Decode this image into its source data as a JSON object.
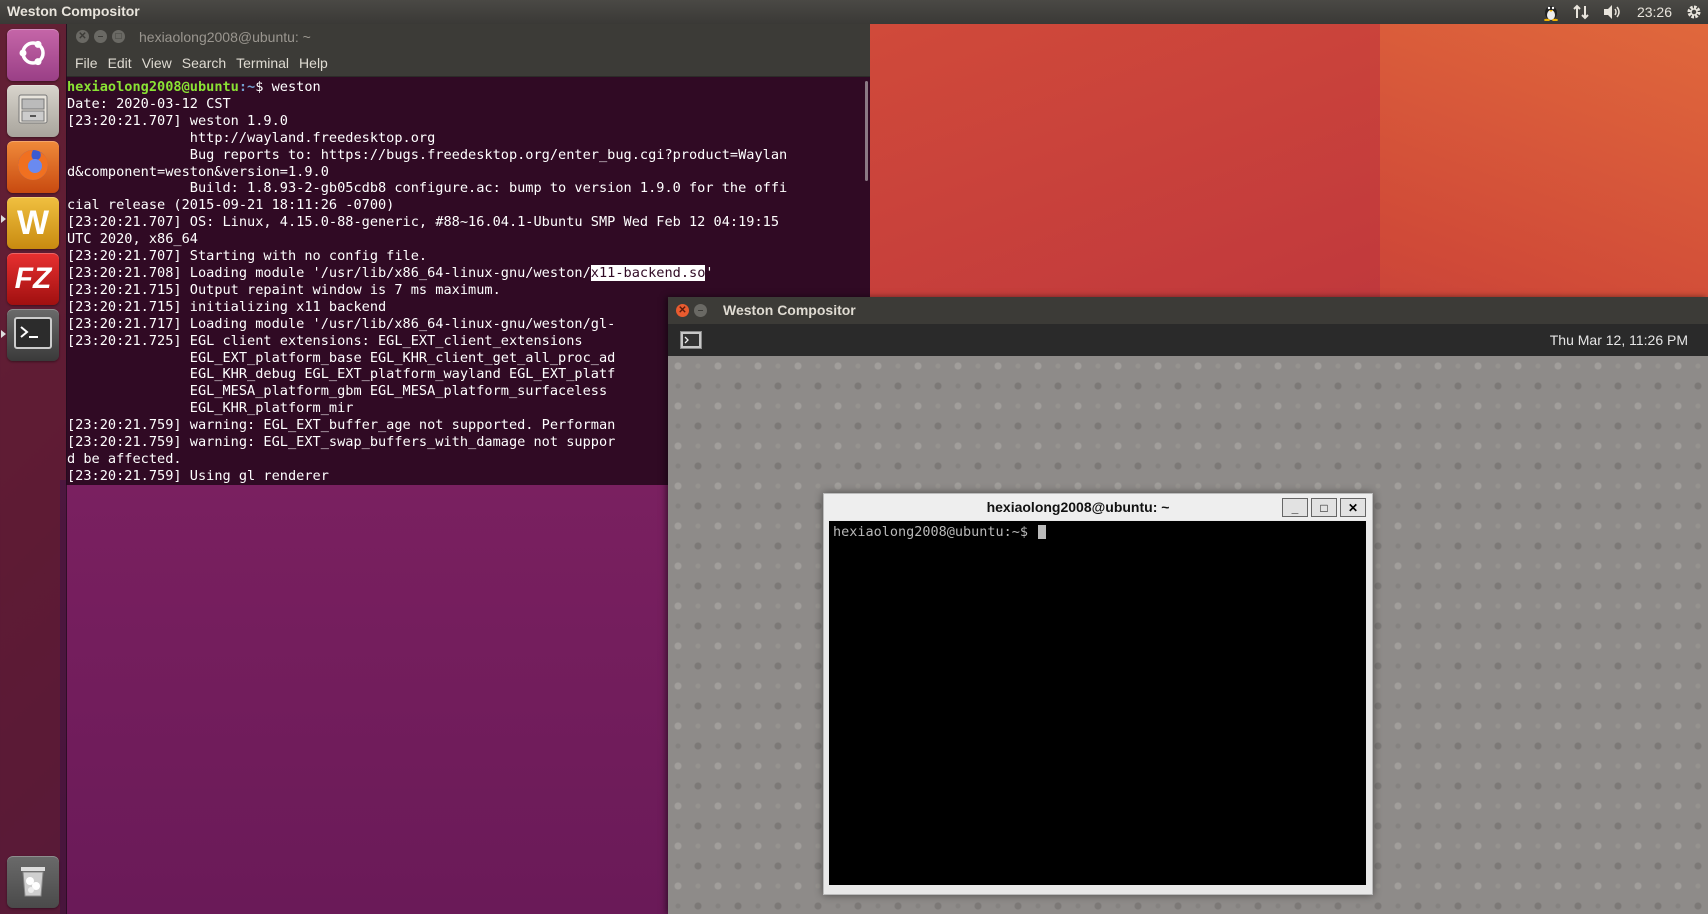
{
  "top_panel": {
    "title": "Weston Compositor",
    "time": "23:26",
    "icons": [
      "tux-icon",
      "network-icon",
      "volume-icon",
      "gear-icon"
    ]
  },
  "launcher": {
    "items": [
      {
        "name": "ubuntu-dash",
        "icon": "ubuntu-logo-icon",
        "color": "#b9559a"
      },
      {
        "name": "files",
        "icon": "file-cabinet-icon",
        "color": "#c8c4bc"
      },
      {
        "name": "firefox",
        "icon": "firefox-icon",
        "color": "#e66000"
      },
      {
        "name": "wps-writer",
        "icon": "wps-icon",
        "color": "#d4a020"
      },
      {
        "name": "filezilla",
        "icon": "filezilla-icon",
        "color": "#c8201c"
      },
      {
        "name": "terminal",
        "icon": "terminal-icon",
        "color": "#4a4a4a"
      }
    ],
    "trash_icon": "trash-icon"
  },
  "gnome_terminal": {
    "title": "hexiaolong2008@ubuntu: ~",
    "menu": [
      "File",
      "Edit",
      "View",
      "Search",
      "Terminal",
      "Help"
    ],
    "prompt_user": "hexiaolong2008@ubuntu",
    "prompt_path": ":~",
    "prompt_cmd": "$ weston",
    "lines": [
      "Date: 2020-03-12 CST",
      "[23:20:21.707] weston 1.9.0",
      "               http://wayland.freedesktop.org",
      "               Bug reports to: https://bugs.freedesktop.org/enter_bug.cgi?product=Waylan",
      "d&component=weston&version=1.9.0",
      "               Build: 1.8.93-2-gb05cdb8 configure.ac: bump to version 1.9.0 for the offi",
      "cial release (2015-09-21 18:11:26 -0700)",
      "[23:20:21.707] OS: Linux, 4.15.0-88-generic, #88~16.04.1-Ubuntu SMP Wed Feb 12 04:19:15",
      "UTC 2020, x86_64",
      "[23:20:21.707] Starting with no config file."
    ],
    "module_line_pre": "[23:20:21.708] Loading module '/usr/lib/x86_64-linux-gnu/weston/",
    "module_line_sel": "x11-backend.so",
    "module_line_post": "'",
    "lines2": [
      "[23:20:21.715] Output repaint window is 7 ms maximum.",
      "[23:20:21.715] initializing x11 backend",
      "[23:20:21.717] Loading module '/usr/lib/x86_64-linux-gnu/weston/gl-",
      "[23:20:21.725] EGL client extensions: EGL_EXT_client_extensions",
      "               EGL_EXT_platform_base EGL_KHR_client_get_all_proc_ad",
      "               EGL_KHR_debug EGL_EXT_platform_wayland EGL_EXT_platf",
      "               EGL_MESA_platform_gbm EGL_MESA_platform_surfaceless",
      "               EGL_KHR_platform_mir",
      "[23:20:21.759] warning: EGL_EXT_buffer_age not supported. Performan",
      "[23:20:21.759] warning: EGL_EXT_swap_buffers_with_damage not suppor",
      "d be affected.",
      "[23:20:21.759] Using gl renderer"
    ]
  },
  "weston": {
    "title": "Weston Compositor",
    "clock": "Thu Mar 12, 11:26 PM",
    "xterm": {
      "title": "hexiaolong2008@ubuntu: ~",
      "prompt": "hexiaolong2008@ubuntu:~$ ",
      "btn_min": "_",
      "btn_max": "□",
      "btn_close": "✕"
    }
  }
}
